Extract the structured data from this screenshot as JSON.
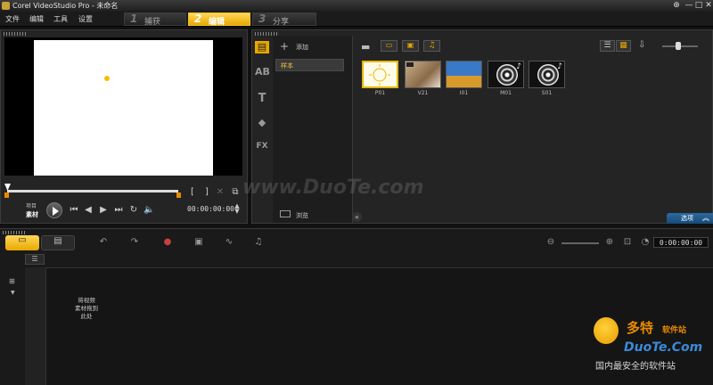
{
  "window": {
    "title": "Corel VideoStudio Pro - 未命名",
    "controls": [
      "⊕",
      "—",
      "□",
      "✕"
    ]
  },
  "menu": [
    "文件",
    "编辑",
    "工具",
    "设置"
  ],
  "steps": [
    {
      "num": "1",
      "label": "捕获",
      "active": false
    },
    {
      "num": "2",
      "label": "编辑",
      "active": true
    },
    {
      "num": "3",
      "label": "分享",
      "active": false
    }
  ],
  "player": {
    "mode_project": "项目",
    "mode_clip": "素材",
    "timecode": "00:00:00:00"
  },
  "library": {
    "add_label": "添加",
    "folder_item": "样本",
    "browse_label": "浏览",
    "thumbs": [
      {
        "label": "P01",
        "type": "photo"
      },
      {
        "label": "V21",
        "type": "video"
      },
      {
        "label": "I01",
        "type": "image"
      },
      {
        "label": "M01",
        "type": "audio"
      },
      {
        "label": "S01",
        "type": "audio"
      }
    ],
    "options_label": "选项"
  },
  "timeline": {
    "timecode": "0:00:00:00",
    "drop_hint": "将视频\n素材拖到\n此处"
  },
  "watermarks": {
    "center": "www.DuoTe.com",
    "brand_cn": "多特",
    "brand_cn_suffix": "软件站",
    "brand_en": "DuoTe.Com",
    "slogan": "国内最安全的软件站"
  }
}
